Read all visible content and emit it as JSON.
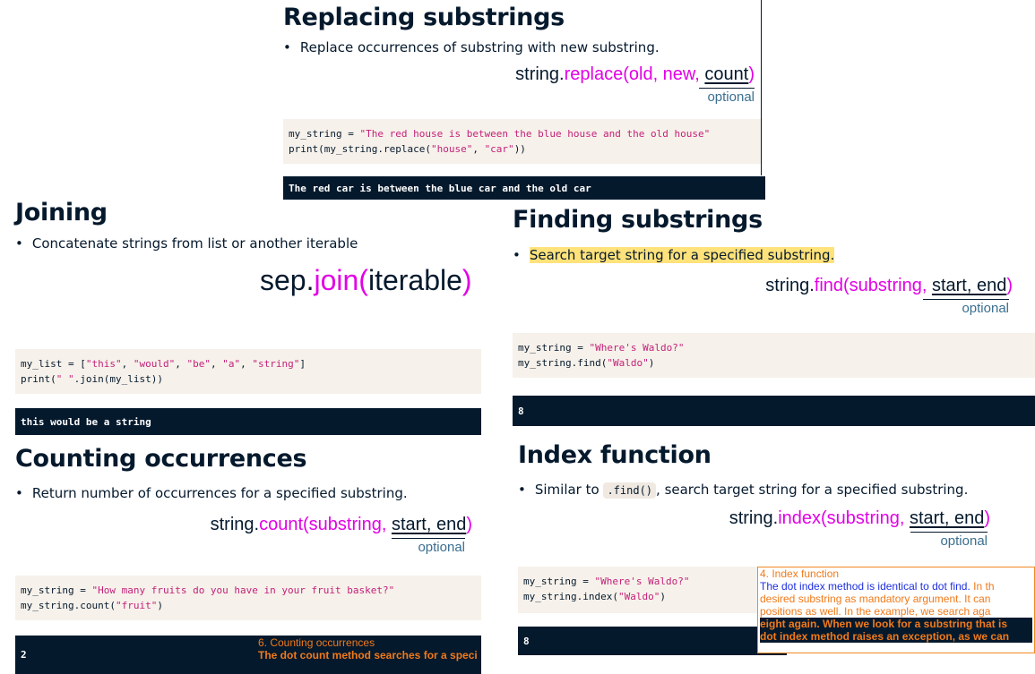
{
  "replacing": {
    "title": "Replacing substrings",
    "bullet": "Replace occurrences of substring with new substring.",
    "sig_obj": "string.",
    "sig_method": "replace(",
    "sig_args": "old, new, ",
    "sig_opt": "count",
    "sig_close": ")",
    "optional": "optional",
    "code_line1_a": "my_string = ",
    "code_line1_s": "\"The red house is between the blue house and the old house\"",
    "code_line2_a": "print(my_string.replace(",
    "code_line2_s1": "\"house\"",
    "code_line2_b": ", ",
    "code_line2_s2": "\"car\"",
    "code_line2_c": "))",
    "output": "The red car is between the blue car and the old car"
  },
  "joining": {
    "title": "Joining",
    "bullet": "Concatenate strings from list or another iterable",
    "sig_obj": "sep.",
    "sig_method": "join(",
    "sig_args": "iterable",
    "sig_close": ")",
    "code_line1_a": "my_list = [",
    "code_line1_s1": "\"this\"",
    "code_line1_s2": "\"would\"",
    "code_line1_s3": "\"be\"",
    "code_line1_s4": "\"a\"",
    "code_line1_s5": "\"string\"",
    "code_line1_sep": ", ",
    "code_line1_end": "]",
    "code_line2_a": "print(",
    "code_line2_s": "\" \"",
    "code_line2_b": ".join(my_list))",
    "output": "this would be a string"
  },
  "finding": {
    "title": "Finding substrings",
    "bullet": "Search target string for a specified substring.",
    "sig_obj": "string.",
    "sig_method": "find(",
    "sig_args": "substring, ",
    "sig_opt": "start, end",
    "sig_close": ")",
    "optional": "optional",
    "code_line1_a": "my_string = ",
    "code_line1_s": "\"Where's Waldo?\"",
    "code_line2_a": "my_string.find(",
    "code_line2_s": "\"Waldo\"",
    "code_line2_b": ")",
    "output": "8"
  },
  "counting": {
    "title": "Counting occurrences",
    "bullet": "Return number of occurrences for a specified substring.",
    "sig_obj": "string.",
    "sig_method": "count(",
    "sig_args": "substring, ",
    "sig_opt": "start, end",
    "sig_close": ")",
    "optional": "optional",
    "code_line1_a": "my_string = ",
    "code_line1_s": "\"How many fruits do you have in your fruit basket?\"",
    "code_line2_a": "my_string.count(",
    "code_line2_s": "\"fruit\"",
    "code_line2_b": ")",
    "output": "2",
    "note_heading": "6. Counting occurrences",
    "note_text": "The dot count method searches for a speci"
  },
  "index": {
    "title": "Index function",
    "bullet_a": "Similar to ",
    "bullet_code": ".find()",
    "bullet_b": ", search target string for a specified substring.",
    "sig_obj": "string.",
    "sig_method": "index(",
    "sig_args": "substring, ",
    "sig_opt": "start, end",
    "sig_close": ")",
    "optional": "optional",
    "code_line1_a": "my_string = ",
    "code_line1_s": "\"Where's Waldo?\"",
    "code_line2_a": "my_string.index(",
    "code_line2_s": "\"Waldo\"",
    "code_line2_b": ")",
    "output": "8",
    "note_heading": "4. Index function",
    "note_l1_b": "The dot index method is identical to dot find. ",
    "note_l1_o": "In th",
    "note_l2": "desired substring as mandatory argument. It can",
    "note_l3": "positions as well. In the example, we search aga",
    "note_l4": "eight again. When we look for a substring that is",
    "note_l5": "dot index method raises an exception, as we can"
  },
  "colors": {
    "accent_method": "#e200e6",
    "code_bg": "#f6f1ea",
    "output_bg": "#05192d",
    "string_literal": "#c3217a",
    "highlight": "#ffe27a",
    "note_orange": "#f07a1a",
    "note_blue": "#1d2fe0"
  }
}
